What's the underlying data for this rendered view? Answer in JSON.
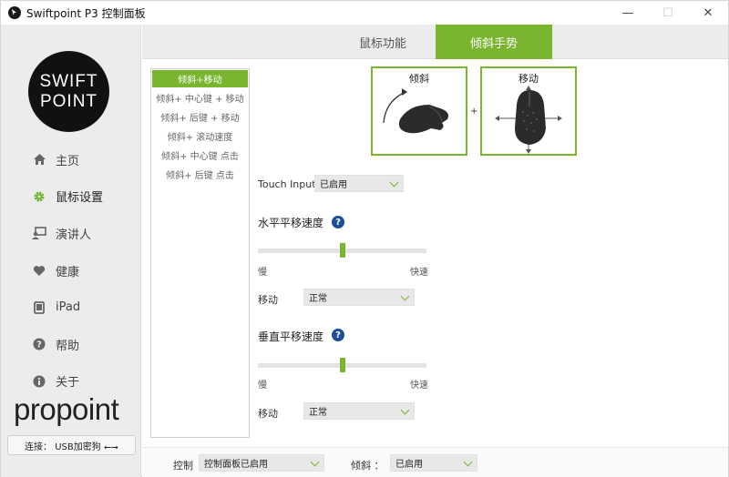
{
  "window": {
    "title": "Swiftpoint P3 控制面板",
    "controls": {
      "minimize": "—",
      "maximize": "☐",
      "close": "✕"
    }
  },
  "sidebar": {
    "logo_line1": "SWIFT",
    "logo_line2": "POINT",
    "items": [
      {
        "label": "主页",
        "icon": "home-icon"
      },
      {
        "label": "鼠标设置",
        "icon": "gear-icon",
        "active": true
      },
      {
        "label": "演讲人",
        "icon": "presenter-icon"
      },
      {
        "label": "健康",
        "icon": "heart-icon"
      },
      {
        "label": "iPad",
        "icon": "tablet-icon"
      },
      {
        "label": "帮助",
        "icon": "help-icon"
      },
      {
        "label": "关于",
        "icon": "info-icon"
      }
    ],
    "brand": "propoint",
    "connection": "连接： USB加密狗 ⭠⭢"
  },
  "tabs": [
    {
      "label": "鼠标功能"
    },
    {
      "label": "倾斜手势",
      "active": true
    }
  ],
  "gesture_list": [
    "倾斜+移动",
    "倾斜+ 中心键 + 移动",
    "倾斜+ 后键 + 移动",
    "倾斜+ 滚动速度",
    "倾斜+ 中心键 点击",
    "倾斜+ 后键 点击"
  ],
  "images": {
    "tilt_caption": "倾斜",
    "move_caption": "移动",
    "plus": "+"
  },
  "settings": {
    "touch_input_label": "Touch Input",
    "touch_input_value": "已启用",
    "horizontal": {
      "title": "水平平移速度",
      "slow": "慢",
      "fast": "快速",
      "slider_value": 0.5,
      "move_label": "移动",
      "move_value": "正常"
    },
    "vertical": {
      "title": "垂直平移速度",
      "slow": "慢",
      "fast": "快速",
      "slider_value": 0.5,
      "move_label": "移动",
      "move_value": "正常"
    }
  },
  "bottom": {
    "control_label": "控制",
    "control_value": "控制面板已启用",
    "tilt_label": "倾斜 ：",
    "tilt_value": "已启用"
  },
  "colors": {
    "accent": "#7ab52f",
    "help": "#1e4e9a",
    "sidebar_bg": "#ececec"
  }
}
